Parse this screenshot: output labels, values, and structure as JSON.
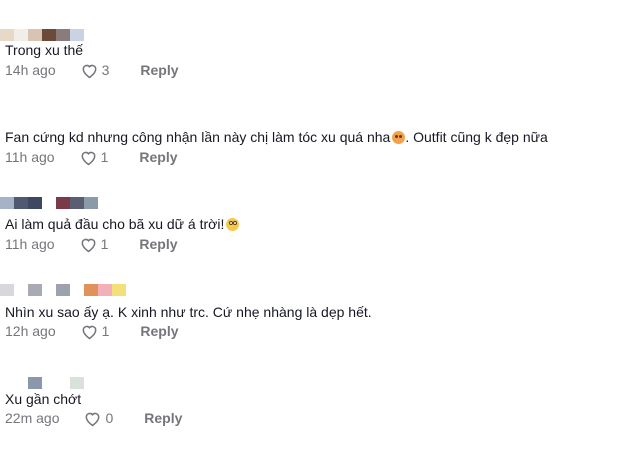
{
  "comments": [
    {
      "text": "Trong xu thế",
      "time": "14h ago",
      "likes": "3",
      "reply": "Reply"
    },
    {
      "text": "Fan cứng kd nhưng công nhận lần này chị làm tóc xu quá nha",
      "text_after_emoji": ". Outfit cũng k đẹp nữa",
      "emoji": "angry-face-emoji",
      "time": "11h ago",
      "likes": "1",
      "reply": "Reply"
    },
    {
      "text": "Ai làm quả đầu cho bã xu dữ á trời!",
      "emoji": "rolling-eyes-emoji",
      "time": "11h ago",
      "likes": "1",
      "reply": "Reply"
    },
    {
      "text": "Nhìn xu sao ấy ạ. K xinh như trc. Cứ nhẹ nhàng là dẹp hết.",
      "time": "12h ago",
      "likes": "1",
      "reply": "Reply"
    },
    {
      "text": "Xu gần chớt",
      "time": "22m ago",
      "likes": "0",
      "reply": "Reply"
    }
  ],
  "colors": {
    "text": "#161823",
    "meta": "#75767c"
  }
}
